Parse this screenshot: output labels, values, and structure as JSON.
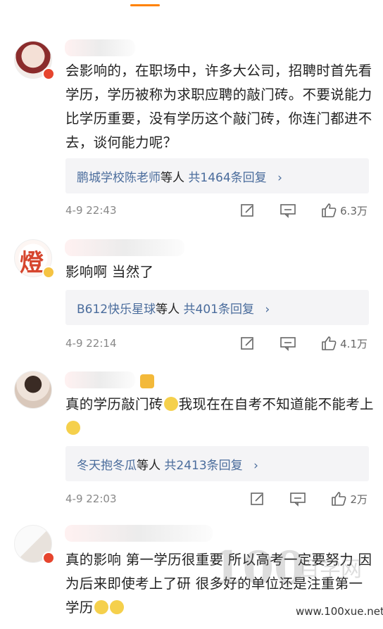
{
  "colors": {
    "accent": "#ff8200",
    "link": "#4a6c9c",
    "meta": "#888888",
    "reply_bg": "#f4f4f6"
  },
  "comments": [
    {
      "text": "会影响的，在职场中，许多大公司，招聘时首先看学历，学历被称为求职应聘的敲门砖。不要说能力比学历重要，没有学历这个敲门砖，你连门都进不去，谈何能力呢？",
      "reply": {
        "name": "鹏城学校陈老师",
        "middle": "等人",
        "count": "共1464条回复"
      },
      "time": "4-9 22:43",
      "likes": "6.3万"
    },
    {
      "text": "影响啊 当然了",
      "reply": {
        "name": "B612快乐星球",
        "middle": "等人",
        "count": "共401条回复"
      },
      "time": "4-9 22:14",
      "likes": "4.1万"
    },
    {
      "text_a": "真的学历敲门砖",
      "text_b": "我现在在自考不知道能不能考上",
      "reply": {
        "name": "冬天抱冬瓜",
        "middle": "等人",
        "count": "共2413条回复"
      },
      "time": "4-9 22:03",
      "likes": "2万"
    },
    {
      "text": "真的影响 第一学历很重要 所以高考一定要努力 因为后来即使考上了研 很多好的单位还是注重第一学历"
    }
  ],
  "icons": [
    "edit-icon",
    "comment-icon",
    "like-icon",
    "chevron-right-icon",
    "verified-badge-icon",
    "emoji-icon"
  ],
  "watermark": {
    "logo": "100",
    "cn": "百学网",
    "url": "www.100xue.net"
  }
}
